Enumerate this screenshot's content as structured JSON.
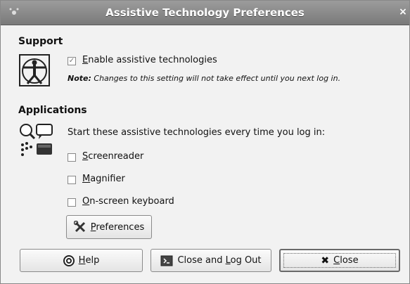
{
  "window": {
    "title": "Assistive Technology Preferences",
    "close_glyph": "×"
  },
  "support": {
    "heading": "Support",
    "enable": {
      "label": "Enable assistive technologies",
      "mnemonic": "E",
      "checked": true
    },
    "note_prefix": "Note:",
    "note_text": "Changes to this setting will not take effect until you next log in.",
    "icon": "accessibility-vitruvian-icon"
  },
  "applications": {
    "heading": "Applications",
    "intro": "Start these assistive technologies every time you log in:",
    "icon": "assistive-apps-icon",
    "items": [
      {
        "label": "Screenreader",
        "mnemonic": "S",
        "rest": "creenreader",
        "checked": false
      },
      {
        "label": "Magnifier",
        "mnemonic": "M",
        "rest": "agnifier",
        "checked": false
      },
      {
        "label": "On-screen keyboard",
        "mnemonic": "O",
        "rest": "n-screen keyboard",
        "checked": false
      }
    ],
    "preferences_button": {
      "mnemonic": "P",
      "rest": "references",
      "icon": "tools-icon"
    }
  },
  "buttons": {
    "help": {
      "mnemonic": "H",
      "rest": "elp",
      "icon": "help-icon"
    },
    "logout": {
      "prefix": "Close and ",
      "mnemonic": "L",
      "rest": "og Out",
      "icon": "logout-icon"
    },
    "close": {
      "mnemonic": "C",
      "rest": "lose",
      "icon": "close-x-icon"
    }
  }
}
